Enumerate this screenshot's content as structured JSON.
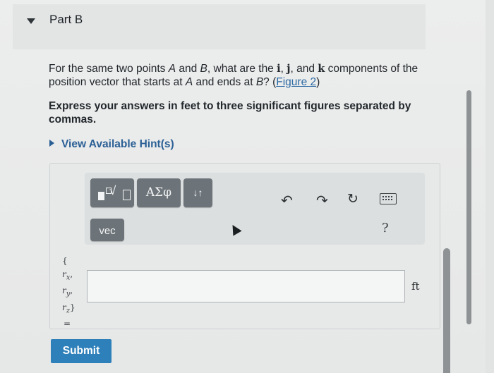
{
  "part": {
    "title": "Part B"
  },
  "question": {
    "text_1": "For the same two points ",
    "point_a": "A",
    "text_2": " and ",
    "point_b": "B",
    "text_3": ", what are the ",
    "unit_i": "i",
    "sep_1": ", ",
    "unit_j": "j",
    "text_4": ", and ",
    "unit_k": "k",
    "text_5": " components of the position vector that starts at ",
    "point_a2": "A",
    "text_6": " and ends at ",
    "point_b2": "B",
    "text_7": "? (",
    "figure_link": "Figure 2",
    "text_8": ")"
  },
  "instruction": "Express your answers in feet to three significant figures separated by commas.",
  "hints": {
    "label": "View Available Hint(s)"
  },
  "toolbar": {
    "greek_label": "ΑΣφ",
    "arrows_label": "↓↑",
    "vec_label": "vec",
    "help_label": "?",
    "icons": [
      "templates-icon",
      "undo-icon",
      "redo-icon",
      "reset-icon",
      "keyboard-icon",
      "help-icon"
    ]
  },
  "answer": {
    "lhs_open": "{",
    "lhs_rx": "r",
    "lhs_rx_sub": "x",
    "lhs_ry": "r",
    "lhs_ry_sub": "y",
    "lhs_rz": "r",
    "lhs_rz_sub": "z",
    "lhs_close": "}",
    "lhs_eq": "=",
    "value": "",
    "unit": "ft"
  },
  "submit_label": "Submit"
}
